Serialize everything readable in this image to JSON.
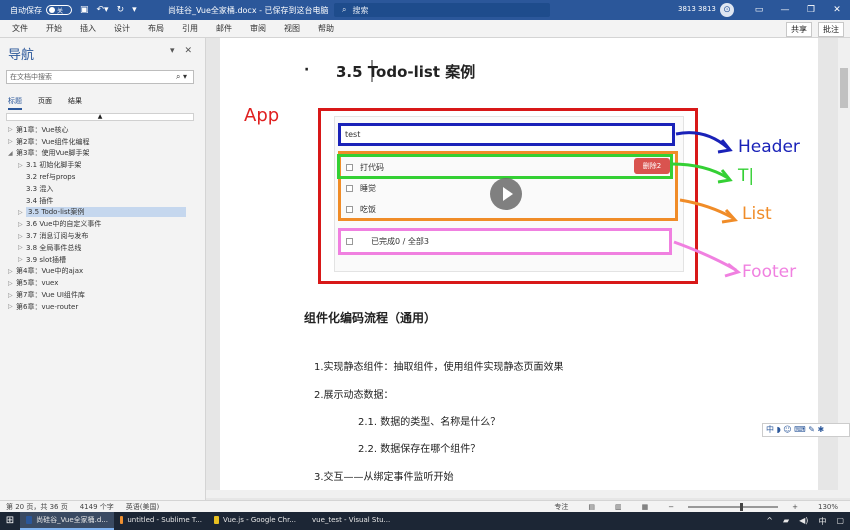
{
  "titlebar": {
    "autosave_label": "自动保存",
    "autosave_state": "关",
    "doc_title": "尚硅谷_Vue全家桶.docx  -  已保存到这台电脑",
    "search_placeholder": "搜索",
    "user": "3813 3813",
    "avatar": "⊙"
  },
  "ribbon": {
    "tabs": [
      "文件",
      "开始",
      "插入",
      "设计",
      "布局",
      "引用",
      "邮件",
      "审阅",
      "视图",
      "帮助"
    ],
    "share": "共享",
    "comments": "批注"
  },
  "nav": {
    "title": "导航",
    "search_placeholder": "在文档中搜索",
    "tabs": [
      "标题",
      "页面",
      "结果"
    ],
    "items": [
      {
        "label": "第1章：Vue核心",
        "level": 0,
        "arrow": "▷"
      },
      {
        "label": "第2章：Vue组件化编程",
        "level": 0,
        "arrow": "▷"
      },
      {
        "label": "第3章：使用Vue脚手架",
        "level": 0,
        "arrow": "◢"
      },
      {
        "label": "3.1 初始化脚手架",
        "level": 1,
        "arrow": "▷"
      },
      {
        "label": "3.2 ref与props",
        "level": 1,
        "arrow": ""
      },
      {
        "label": "3.3 混入",
        "level": 1,
        "arrow": ""
      },
      {
        "label": "3.4 插件",
        "level": 1,
        "arrow": ""
      },
      {
        "label": "3.5 Todo-list案例",
        "level": 1,
        "arrow": "▷",
        "selected": true
      },
      {
        "label": "3.6 Vue中的自定义事件",
        "level": 1,
        "arrow": "▷"
      },
      {
        "label": "3.7 消息订阅与发布",
        "level": 1,
        "arrow": "▷"
      },
      {
        "label": "3.8 全局事件总线",
        "level": 1,
        "arrow": "▷"
      },
      {
        "label": "3.9 slot插槽",
        "level": 1,
        "arrow": "▷"
      },
      {
        "label": "第4章：Vue中的ajax",
        "level": 0,
        "arrow": "▷"
      },
      {
        "label": "第5章：vuex",
        "level": 0,
        "arrow": "▷"
      },
      {
        "label": "第7章：Vue UI组件库",
        "level": 0,
        "arrow": "▷"
      },
      {
        "label": "第6章：vue-router",
        "level": 0,
        "arrow": "▷"
      }
    ]
  },
  "doc": {
    "bullet": "·",
    "heading": "3.5  Todo-list 案例",
    "app_label": "App",
    "header_input": "test",
    "todos": [
      {
        "label": "打代码"
      },
      {
        "label": "睡觉"
      },
      {
        "label": "吃饭"
      }
    ],
    "delete_label": "删除2",
    "footer_text": "已完成0 / 全部3",
    "annot": {
      "header": "Header",
      "item": "T|",
      "list": "List",
      "footer": "Footer"
    },
    "section_title": "组件化编码流程（通用）",
    "paragraphs": [
      "1.实现静态组件：抽取组件，使用组件实现静态页面效果",
      "2.展示动态数据：",
      "2.1.  数据的类型、名称是什么？",
      "2.2.  数据保存在哪个组件？",
      "3.交互——从绑定事件监听开始"
    ]
  },
  "ime": "中 ◗ ☺ ⌨ ✎ ✱",
  "status": {
    "page": "第 20 页，共 36 页",
    "words": "4149 个字",
    "lang": "英语(美国)",
    "focus": "专注",
    "zoom": "130%"
  },
  "taskbar": {
    "tasks": [
      {
        "label": "尚硅谷_Vue全家桶.d...",
        "color": "#2b579a"
      },
      {
        "label": "untitled - Sublime T...",
        "color": "#f09030"
      },
      {
        "label": "Vue.js - Google Chr...",
        "color": "#e8c020"
      },
      {
        "label": "vue_test - Visual Stu...",
        "color": "#3c8ce0"
      }
    ]
  }
}
